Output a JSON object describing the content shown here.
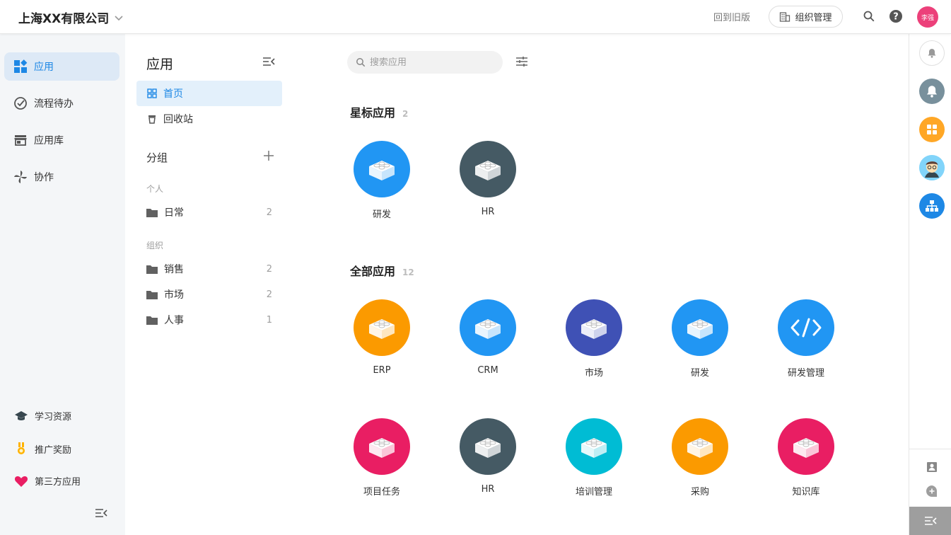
{
  "header": {
    "company": "上海XX有限公司",
    "back_old": "回到旧版",
    "org_manage": "组织管理",
    "avatar_text": "李强"
  },
  "leftnav": {
    "items": [
      {
        "label": "应用",
        "icon": "apps-icon",
        "active": true
      },
      {
        "label": "流程待办",
        "icon": "check-circle-icon"
      },
      {
        "label": "应用库",
        "icon": "store-icon"
      },
      {
        "label": "协作",
        "icon": "pinwheel-icon"
      }
    ],
    "bottom": [
      {
        "label": "学习资源",
        "icon": "graduation-cap-icon"
      },
      {
        "label": "推广奖励",
        "icon": "medal-icon"
      },
      {
        "label": "第三方应用",
        "icon": "heart-icon"
      }
    ]
  },
  "panel": {
    "title": "应用",
    "menu": [
      {
        "label": "首页",
        "icon": "grid-icon",
        "active": true
      },
      {
        "label": "回收站",
        "icon": "trash-icon"
      }
    ],
    "group_title": "分组",
    "personal_label": "个人",
    "personal": [
      {
        "name": "日常",
        "count": "2"
      }
    ],
    "org_label": "组织",
    "org": [
      {
        "name": "销售",
        "count": "2"
      },
      {
        "name": "市场",
        "count": "2"
      },
      {
        "name": "人事",
        "count": "1"
      }
    ]
  },
  "main": {
    "search_placeholder": "搜索应用",
    "starred_title": "星标应用",
    "starred_count": "2",
    "starred": [
      {
        "name": "研发",
        "color": "#2196f3",
        "icon": "lego-brick-icon"
      },
      {
        "name": "HR",
        "color": "#455a64",
        "icon": "lego-brick-icon"
      }
    ],
    "all_title": "全部应用",
    "all_count": "12",
    "all": [
      {
        "name": "ERP",
        "color": "#fb9a00",
        "icon": "lego-brick-icon"
      },
      {
        "name": "CRM",
        "color": "#2196f3",
        "icon": "lego-brick-icon"
      },
      {
        "name": "市场",
        "color": "#3f51b5",
        "icon": "lego-brick-icon"
      },
      {
        "name": "研发",
        "color": "#2196f3",
        "icon": "lego-brick-icon"
      },
      {
        "name": "研发管理",
        "color": "#2196f3",
        "icon": "code-icon"
      },
      {
        "name": "项目任务",
        "color": "#e91e63",
        "icon": "lego-brick-icon"
      },
      {
        "name": "HR",
        "color": "#455a64",
        "icon": "lego-brick-icon"
      },
      {
        "name": "培训管理",
        "color": "#00bcd4",
        "icon": "lego-brick-icon"
      },
      {
        "name": "采购",
        "color": "#fb9a00",
        "icon": "lego-brick-icon"
      },
      {
        "name": "知识库",
        "color": "#e91e63",
        "icon": "lego-brick-icon"
      }
    ]
  },
  "colors": {
    "accent": "#1e88e5",
    "nav_active_bg": "#dde9f6"
  }
}
